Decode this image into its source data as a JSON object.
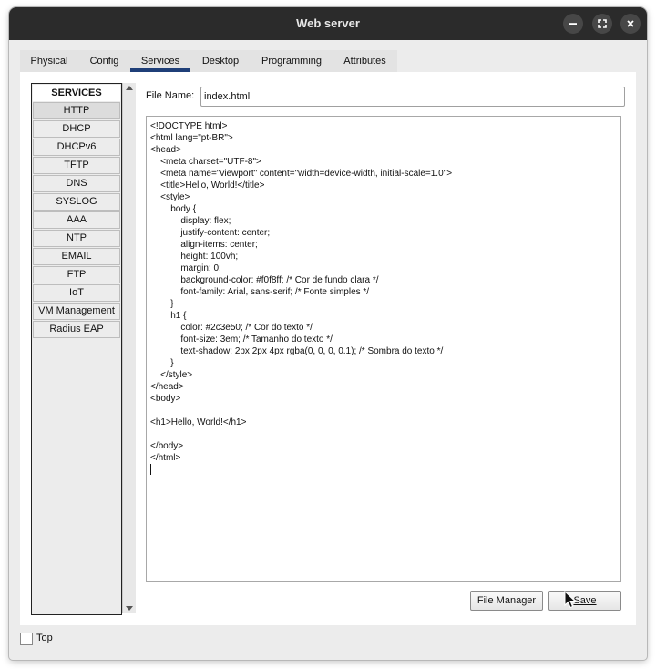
{
  "window": {
    "title": "Web server",
    "controls": [
      "minimize-icon",
      "maximize-icon",
      "close-icon"
    ]
  },
  "tabs": [
    {
      "label": "Physical",
      "active": false
    },
    {
      "label": "Config",
      "active": false
    },
    {
      "label": "Services",
      "active": true
    },
    {
      "label": "Desktop",
      "active": false
    },
    {
      "label": "Programming",
      "active": false
    },
    {
      "label": "Attributes",
      "active": false
    }
  ],
  "services": {
    "header": "SERVICES",
    "items": [
      "HTTP",
      "DHCP",
      "DHCPv6",
      "TFTP",
      "DNS",
      "SYSLOG",
      "AAA",
      "NTP",
      "EMAIL",
      "FTP",
      "IoT",
      "VM Management",
      "Radius EAP"
    ],
    "selected": "HTTP"
  },
  "file": {
    "label": "File Name:",
    "value": "index.html"
  },
  "editor": {
    "lines": [
      "<!DOCTYPE html>",
      "<html lang=\"pt-BR\">",
      "<head>",
      "    <meta charset=\"UTF-8\">",
      "    <meta name=\"viewport\" content=\"width=device-width, initial-scale=1.0\">",
      "    <title>Hello, World!</title>",
      "    <style>",
      "        body {",
      "            display: flex;",
      "            justify-content: center;",
      "            align-items: center;",
      "            height: 100vh;",
      "            margin: 0;",
      "            background-color: #f0f8ff; /* Cor de fundo clara */",
      "            font-family: Arial, sans-serif; /* Fonte simples */",
      "        }",
      "        h1 {",
      "            color: #2c3e50; /* Cor do texto */",
      "            font-size: 3em; /* Tamanho do texto */",
      "            text-shadow: 2px 2px 4px rgba(0, 0, 0, 0.1); /* Sombra do texto */",
      "        }",
      "    </style>",
      "</head>",
      "<body>",
      "",
      "<h1>Hello, World!</h1>",
      "",
      "</body>",
      "</html>"
    ]
  },
  "buttons": {
    "file_manager": "File Manager",
    "save": "Save"
  },
  "footer": {
    "top_label": "Top",
    "top_checked": false
  },
  "colors": {
    "titlebar": "#2b2b2b",
    "active_tab_indicator": "#1f3f78"
  }
}
